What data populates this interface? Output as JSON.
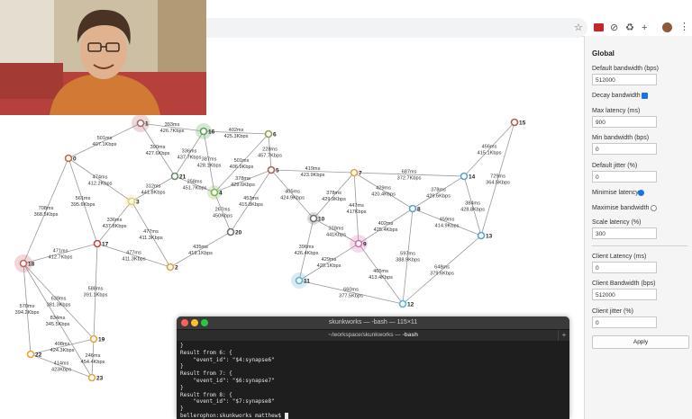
{
  "settings": {
    "title": "Global",
    "default_bandwidth_label": "Default bandwidth (bps)",
    "default_bandwidth_value": "512000",
    "decay_bandwidth_label": "Decay bandwidth",
    "decay_bandwidth_checked": true,
    "max_latency_label": "Max latency (ms)",
    "max_latency_value": "900",
    "min_bandwidth_label": "Min bandwidth (bps)",
    "min_bandwidth_value": "0",
    "default_jitter_label": "Default jitter (%)",
    "default_jitter_value": "0",
    "minimise_latency_label": "Minimise latency",
    "minimise_latency_selected": true,
    "maximise_bandwidth_label": "Maximise bandwidth",
    "maximise_bandwidth_selected": false,
    "scale_latency_label": "Scale latency (%)",
    "scale_latency_value": "300",
    "client_latency_label": "Client Latency (ms)",
    "client_latency_value": "0",
    "client_bandwidth_label": "Client Bandwidth (bps)",
    "client_bandwidth_value": "512000",
    "client_jitter_label": "Client jitter (%)",
    "client_jitter_value": "0",
    "apply_label": "Apply"
  },
  "terminal": {
    "title": "skunkworks — -bash — 115×11",
    "tab_path": "~/workspace/skunkworks — ",
    "tab_cmd": "-bash",
    "lines": [
      "}",
      "Result from 6: {",
      "    \"event_id\": \"$4:synapse6\"",
      "}",
      "Result from 7: {",
      "    \"event_id\": \"$6:synapse7\"",
      "}",
      "Result from 8: {",
      "    \"event_id\": \"$7:synapse8\"",
      "}"
    ],
    "prompt": "bellerophon:skunkworks matthew$ "
  },
  "nodes": [
    {
      "id": "0",
      "color": "#d06040"
    },
    {
      "id": "1",
      "color": "#b06868"
    },
    {
      "id": "2",
      "color": "#e8a040"
    },
    {
      "id": "3",
      "color": "#e0d070"
    },
    {
      "id": "4",
      "color": "#7ab84a"
    },
    {
      "id": "5",
      "color": "#b06050"
    },
    {
      "id": "6",
      "color": "#90a050"
    },
    {
      "id": "7",
      "color": "#e8a040"
    },
    {
      "id": "8",
      "color": "#60a0c8"
    },
    {
      "id": "9",
      "color": "#d070b0"
    },
    {
      "id": "10",
      "color": "#707070"
    },
    {
      "id": "11",
      "color": "#60b0d8"
    },
    {
      "id": "12",
      "color": "#60b0d8"
    },
    {
      "id": "13",
      "color": "#60a0c8"
    },
    {
      "id": "14",
      "color": "#60a0d0"
    },
    {
      "id": "15",
      "color": "#b06040"
    },
    {
      "id": "16",
      "color": "#60a060"
    },
    {
      "id": "17",
      "color": "#c84040"
    },
    {
      "id": "18",
      "color": "#c86060"
    },
    {
      "id": "19",
      "color": "#e8a040"
    },
    {
      "id": "20",
      "color": "#707070"
    },
    {
      "id": "21",
      "color": "#708870"
    },
    {
      "id": "22",
      "color": "#e8a040"
    },
    {
      "id": "23",
      "color": "#e8a040"
    }
  ],
  "edges": [
    {
      "from": "1",
      "to": "0",
      "ms": "501ms",
      "kbps": "407.1Kbps"
    },
    {
      "from": "1",
      "to": "16",
      "ms": "393ms",
      "kbps": "426.7Kbps"
    },
    {
      "from": "1",
      "to": "21",
      "ms": "390ms",
      "kbps": "427.6Kbps"
    },
    {
      "from": "16",
      "to": "21",
      "ms": "336ms",
      "kbps": "437.7Kbps"
    },
    {
      "from": "16",
      "to": "4",
      "ms": "387ms",
      "kbps": "428.1Kbps"
    },
    {
      "from": "16",
      "to": "6",
      "ms": "402ms",
      "kbps": "425.3Kbps"
    },
    {
      "from": "6",
      "to": "4",
      "ms": "501ms",
      "kbps": "406.9Kbps"
    },
    {
      "from": "6",
      "to": "5",
      "ms": "228ms",
      "kbps": "457.7Kbps"
    },
    {
      "from": "21",
      "to": "4",
      "ms": "258ms",
      "kbps": "451.7Kbps"
    },
    {
      "from": "21",
      "to": "3",
      "ms": "312ms",
      "kbps": "441.8Kbps"
    },
    {
      "from": "4",
      "to": "5",
      "ms": "378ms",
      "kbps": "429.6Kbps"
    },
    {
      "from": "4",
      "to": "20",
      "ms": "267ms",
      "kbps": "450Kbps"
    },
    {
      "from": "5",
      "to": "20",
      "ms": "453ms",
      "kbps": "415.8Kbps"
    },
    {
      "from": "5",
      "to": "7",
      "ms": "419ms",
      "kbps": "423.9Kbps"
    },
    {
      "from": "5",
      "to": "10",
      "ms": "405ms",
      "kbps": "424.9Kbps"
    },
    {
      "from": "0",
      "to": "3",
      "ms": "474ms",
      "kbps": "412.2Kbps"
    },
    {
      "from": "0",
      "to": "17",
      "ms": "561ms",
      "kbps": "395.6Kbps"
    },
    {
      "from": "0",
      "to": "18",
      "ms": "708ms",
      "kbps": "368.5Kbps"
    },
    {
      "from": "3",
      "to": "17",
      "ms": "336ms",
      "kbps": "437.8Kbps"
    },
    {
      "from": "3",
      "to": "2",
      "ms": "477ms",
      "kbps": "411.3Kbps"
    },
    {
      "from": "17",
      "to": "2",
      "ms": "477ms",
      "kbps": "411.3Kbps"
    },
    {
      "from": "17",
      "to": "18",
      "ms": "471ms",
      "kbps": "412.7Kbps"
    },
    {
      "from": "17",
      "to": "19",
      "ms": "588ms",
      "kbps": "391.1Kbps"
    },
    {
      "from": "20",
      "to": "2",
      "ms": "435ms",
      "kbps": "419.1Kbps"
    },
    {
      "from": "18",
      "to": "19",
      "ms": "639ms",
      "kbps": "381.3Kbps"
    },
    {
      "from": "18",
      "to": "22",
      "ms": "570ms",
      "kbps": "394.2Kbps"
    },
    {
      "from": "18",
      "to": "23",
      "ms": "834ms",
      "kbps": "345.5Kbps"
    },
    {
      "from": "22",
      "to": "19",
      "ms": "408ms",
      "kbps": "424.3Kbps"
    },
    {
      "from": "22",
      "to": "23",
      "ms": "414ms",
      "kbps": "423Kbps"
    },
    {
      "from": "19",
      "to": "23",
      "ms": "246ms",
      "kbps": "454.4Kbps"
    },
    {
      "from": "7",
      "to": "10",
      "ms": "378ms",
      "kbps": "429.9Kbps"
    },
    {
      "from": "7",
      "to": "9",
      "ms": "447ms",
      "kbps": "417Kbps"
    },
    {
      "from": "7",
      "to": "8",
      "ms": "429ms",
      "kbps": "420.4Kbps"
    },
    {
      "from": "7",
      "to": "14",
      "ms": "687ms",
      "kbps": "372.7Kbps"
    },
    {
      "from": "10",
      "to": "9",
      "ms": "318ms",
      "kbps": "441Kbps"
    },
    {
      "from": "10",
      "to": "11",
      "ms": "396ms",
      "kbps": "426.4Kbps"
    },
    {
      "from": "9",
      "to": "8",
      "ms": "402ms",
      "kbps": "425.4Kbps"
    },
    {
      "from": "9",
      "to": "11",
      "ms": "429ms",
      "kbps": "420.1Kbps"
    },
    {
      "from": "9",
      "to": "12",
      "ms": "465ms",
      "kbps": "413.4Kbps"
    },
    {
      "from": "8",
      "to": "12",
      "ms": "597ms",
      "kbps": "388.9Kbps"
    },
    {
      "from": "8",
      "to": "14",
      "ms": "378ms",
      "kbps": "429.6Kbps"
    },
    {
      "from": "8",
      "to": "13",
      "ms": "459ms",
      "kbps": "414.9Kbps"
    },
    {
      "from": "14",
      "to": "13",
      "ms": "384ms",
      "kbps": "428.8Kbps"
    },
    {
      "from": "14",
      "to": "15",
      "ms": "456ms",
      "kbps": "415.1Kbps"
    },
    {
      "from": "13",
      "to": "15",
      "ms": "729ms",
      "kbps": "364.5Kbps"
    },
    {
      "from": "13",
      "to": "12",
      "ms": "648ms",
      "kbps": "379.6Kbps"
    },
    {
      "from": "11",
      "to": "12",
      "ms": "660ms",
      "kbps": "377.5Kbps"
    }
  ],
  "accent_color": "#1a73e8"
}
